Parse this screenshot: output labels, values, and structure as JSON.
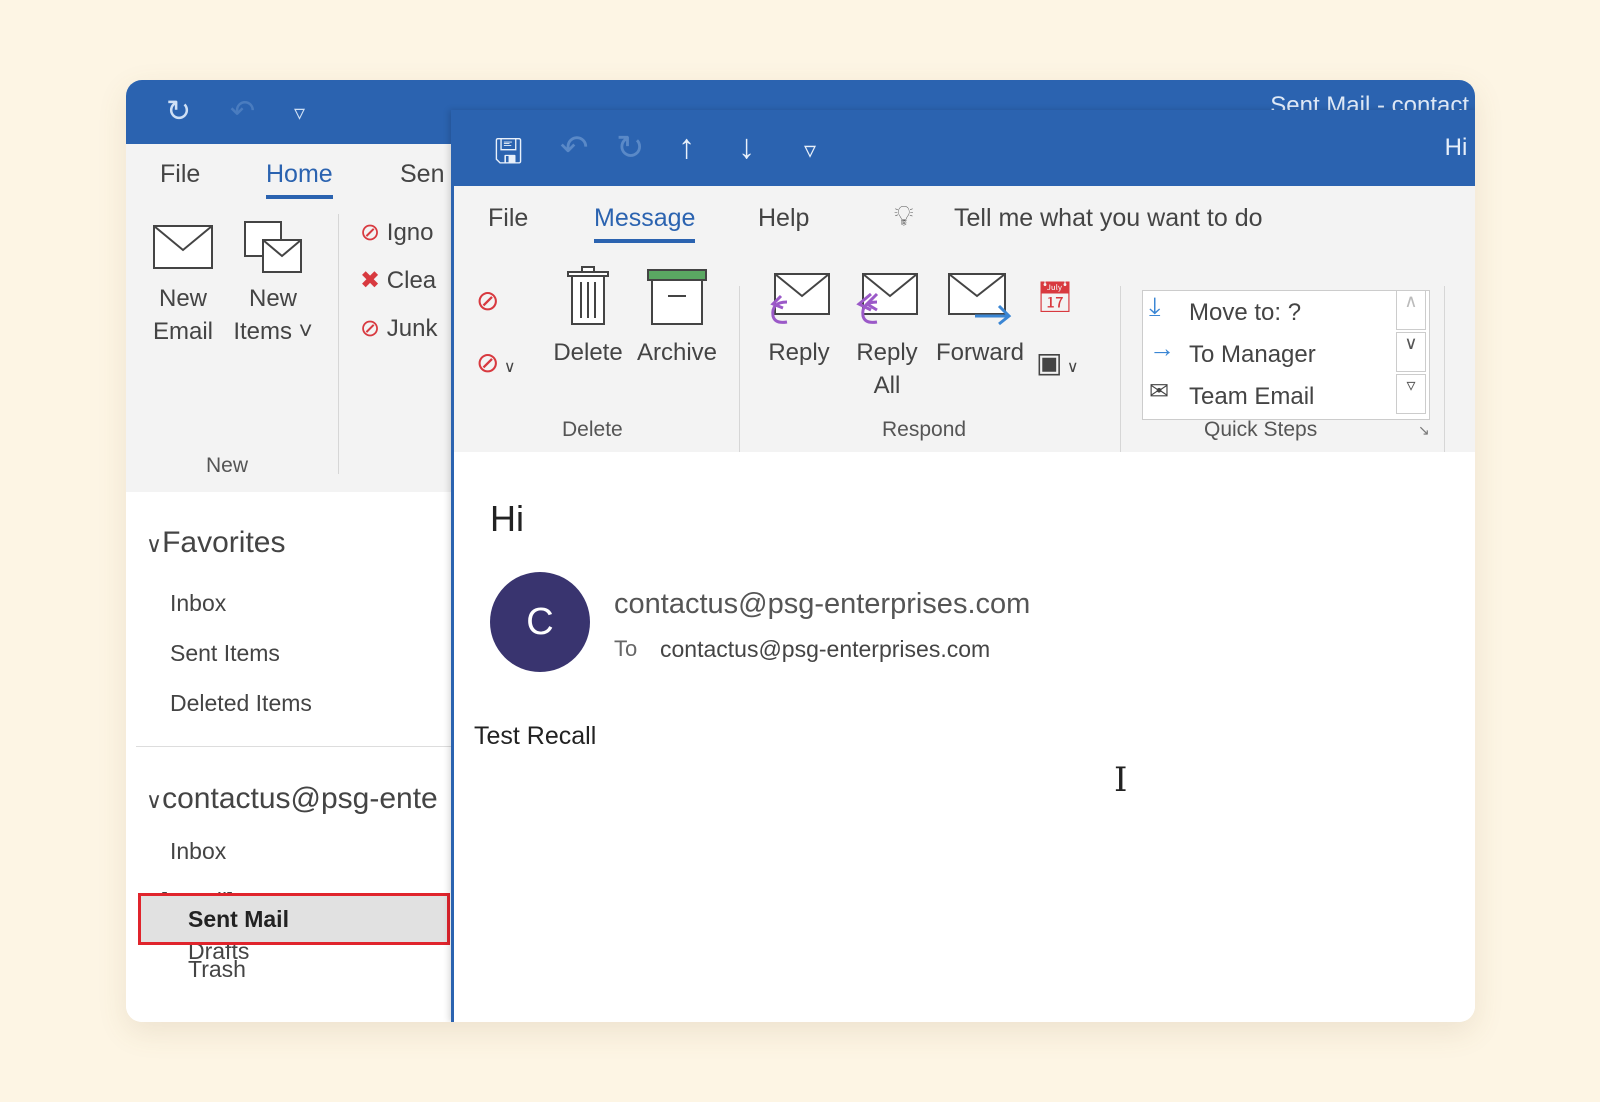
{
  "main_window": {
    "title": "Sent Mail - contact",
    "tabs": [
      "File",
      "Home",
      "Sen"
    ],
    "ribbon": {
      "new_email": [
        "New",
        "Email"
      ],
      "new_items": [
        "New",
        "Items ˅"
      ],
      "group_new": "New",
      "ignore": "Igno",
      "clean_up": "Clea",
      "junk": "Junk"
    },
    "favorites": {
      "header": "Favorites",
      "items": [
        "Inbox",
        "Sent Items",
        "Deleted Items"
      ]
    },
    "account": {
      "header": "contactus@psg-ente",
      "inbox": "Inbox",
      "gmail": "[Gmail]",
      "gmail_items": [
        "Drafts",
        "Sent Mail",
        "Trash"
      ]
    }
  },
  "message_window": {
    "title": "Hi -",
    "tabs": [
      "File",
      "Message",
      "Help"
    ],
    "tell_me": "Tell me what you want to do",
    "ribbon": {
      "delete": "Delete",
      "archive": "Archive",
      "group_delete": "Delete",
      "reply": "Reply",
      "reply_all": [
        "Reply",
        "All"
      ],
      "forward": "Forward",
      "group_respond": "Respond",
      "quick_steps": [
        "Move to: ?",
        "To Manager",
        "Team Email"
      ],
      "group_quick_steps": "Quick Steps"
    },
    "subject": "Hi",
    "avatar_letter": "C",
    "from": "contactus@psg-enterprises.com",
    "to_label": "To",
    "to": "contactus@psg-enterprises.com",
    "body": "Test Recall"
  },
  "colors": {
    "accent": "#2b63b0",
    "avatar": "#39346f",
    "highlight_border": "#e0242c",
    "background": "#fdf5e4"
  }
}
